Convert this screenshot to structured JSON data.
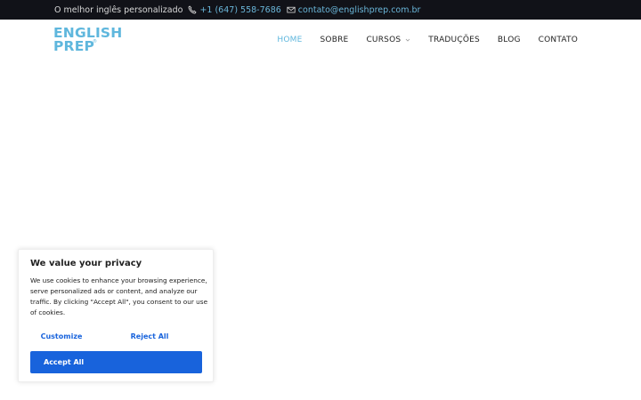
{
  "colors": {
    "topbar_bg": "#111218",
    "accent": "#5fb7dd",
    "link": "#6ab6d9",
    "cookie_button": "#1863dc"
  },
  "topbar": {
    "tagline": "O melhor inglês personalizado",
    "phone": "+1 (647) 558-7686",
    "email": "contato@englishprep.com.br",
    "icons": [
      "phone-icon",
      "mail-icon"
    ]
  },
  "logo": {
    "line1": "ENGLISH",
    "line2": "PREP",
    "registered": "®"
  },
  "nav": {
    "items": [
      {
        "label": "HOME",
        "active": true
      },
      {
        "label": "SOBRE"
      },
      {
        "label": "CURSOS",
        "icon": "chevron-down-icon"
      },
      {
        "label": "TRADUÇÕES"
      },
      {
        "label": "BLOG"
      },
      {
        "label": "CONTATO"
      }
    ]
  },
  "cookie": {
    "title": "We value your privacy",
    "text": "We use cookies to enhance your browsing experience, serve personalized ads or content, and analyze our traffic. By clicking \"Accept All\", you consent to our use of cookies.",
    "customize_label": "Customize",
    "reject_label": "Reject All",
    "accept_label": "Accept All"
  }
}
